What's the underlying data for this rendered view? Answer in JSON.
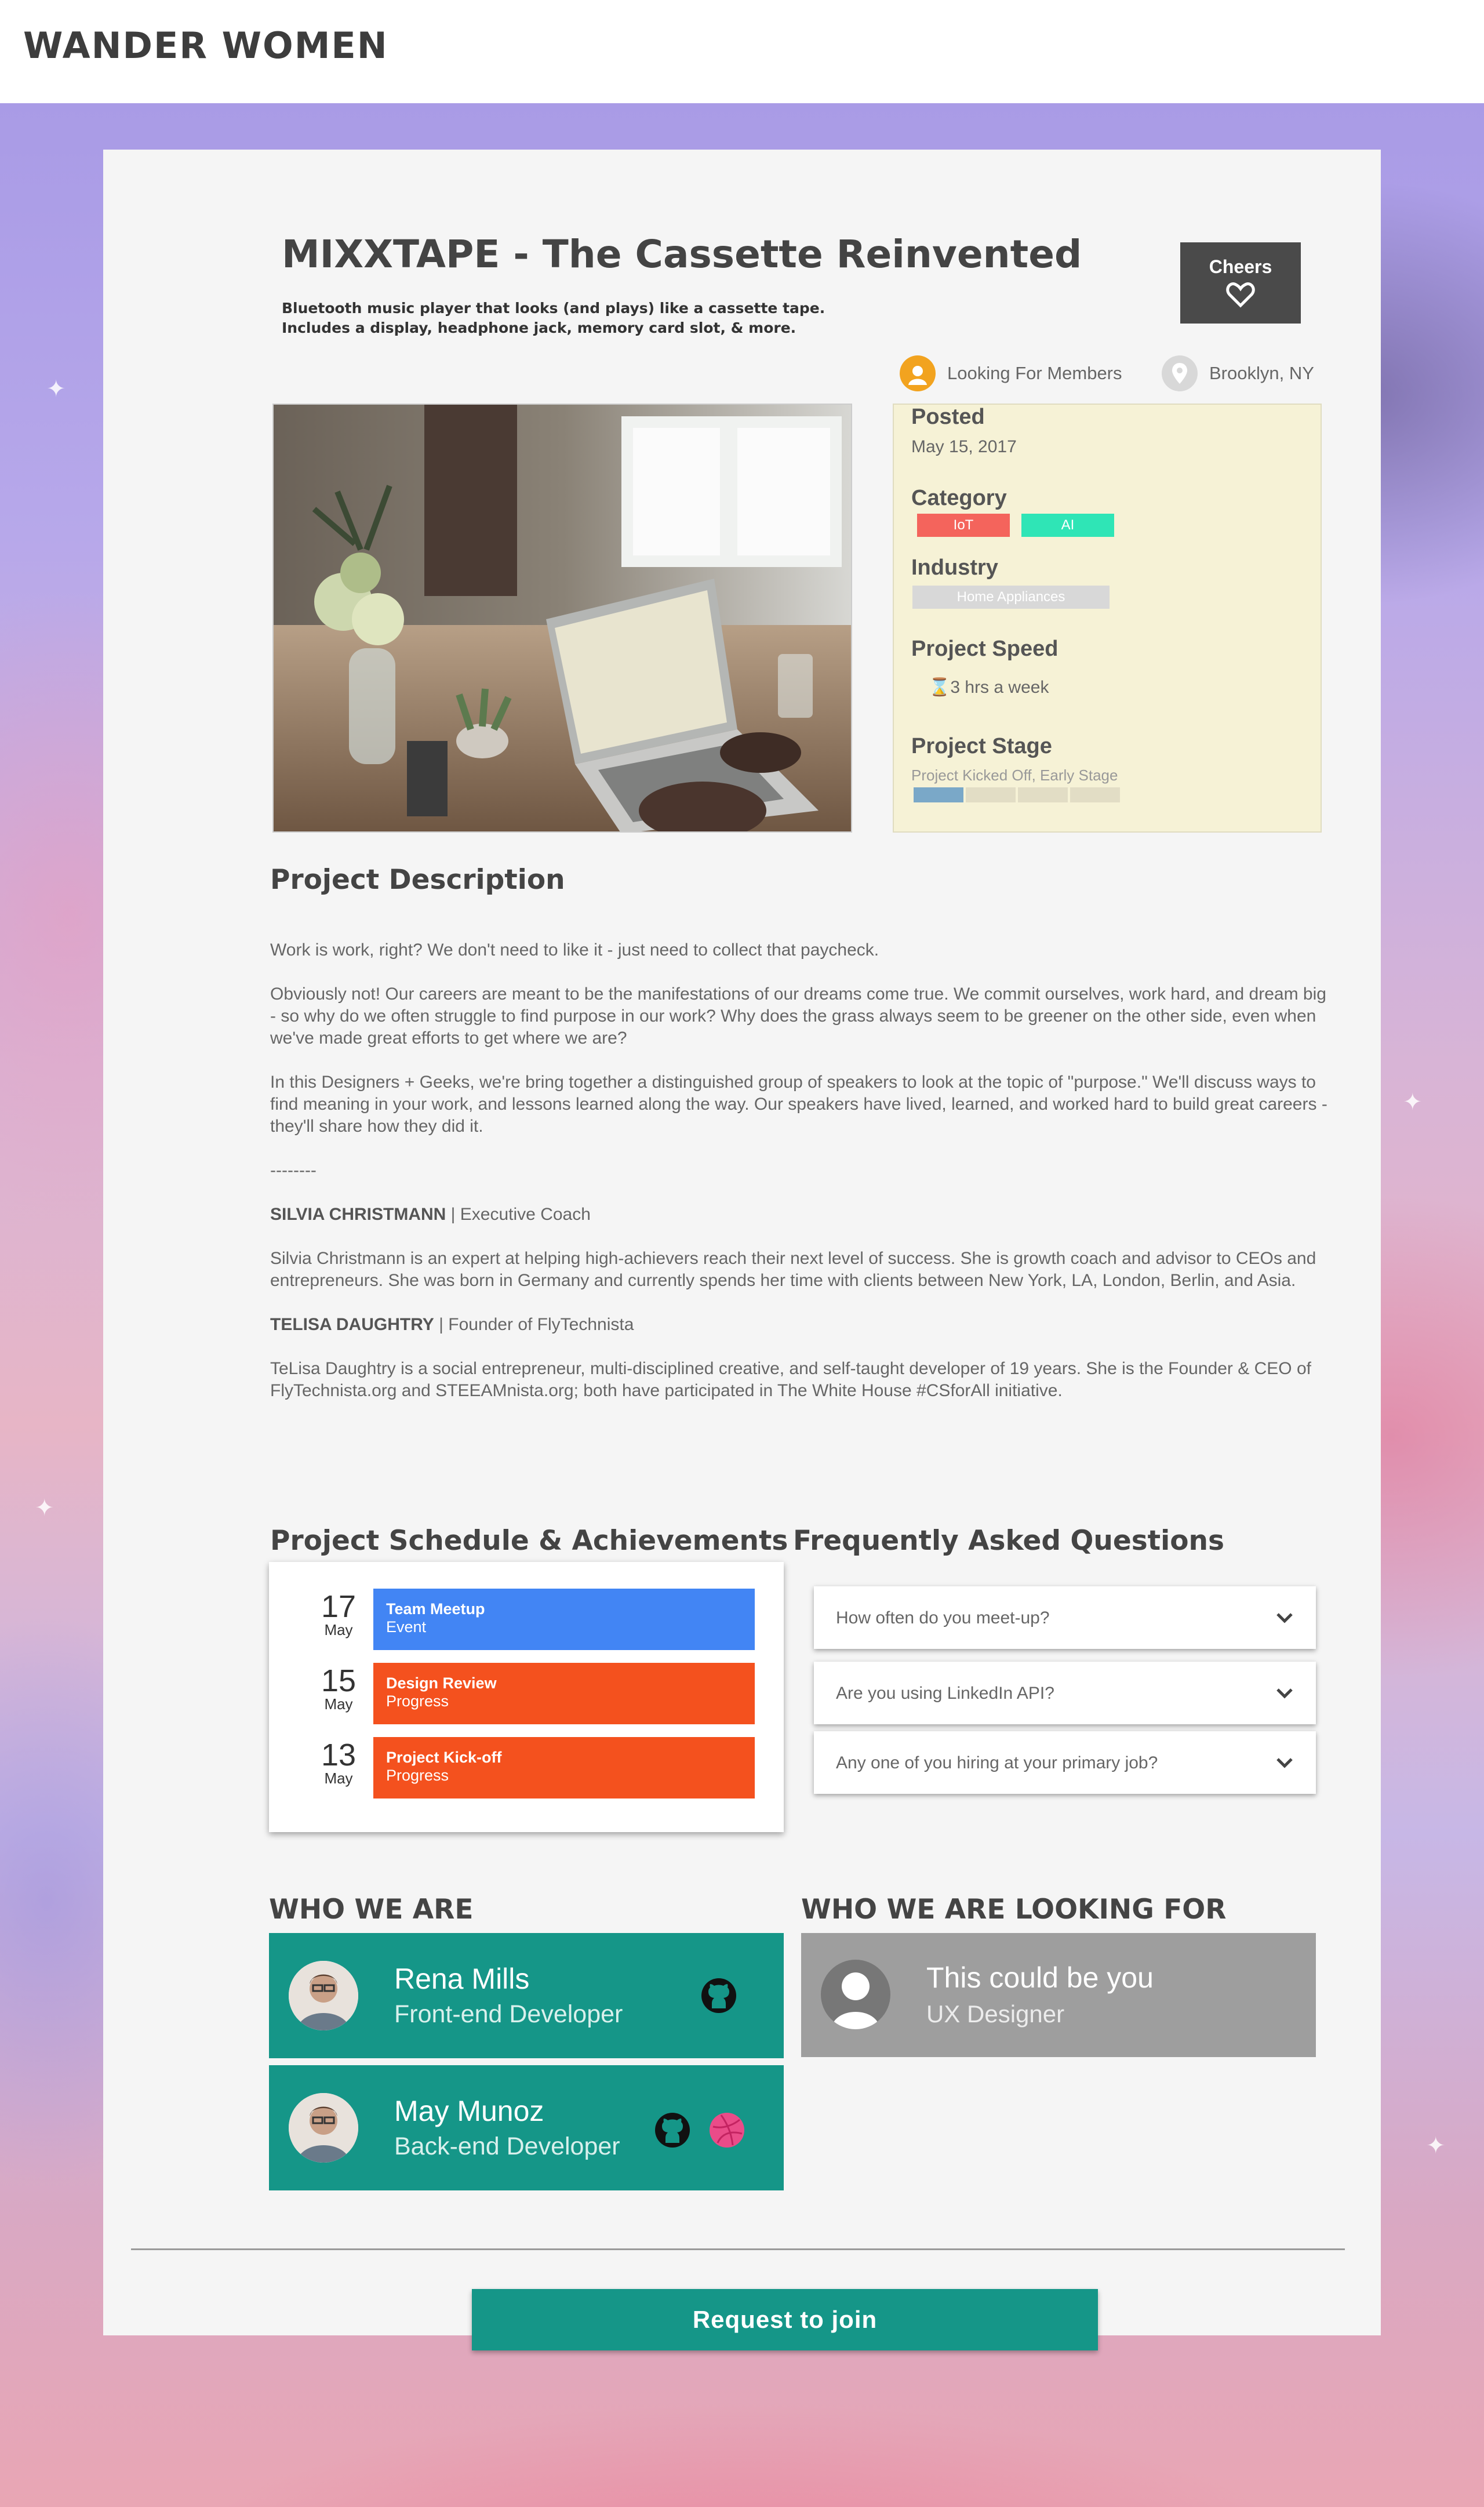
{
  "brand": "WANDER WOMEN",
  "project": {
    "title": "MIXXTAPE - The Cassette Reinvented",
    "subtitle_line1": "Bluetooth music player that looks (and plays) like a cassette tape.",
    "subtitle_line2": "Includes a display, headphone jack, memory card slot, & more."
  },
  "cheers_label": "Cheers",
  "meta": {
    "status": "Looking For Members",
    "location": "Brooklyn, NY"
  },
  "info": {
    "posted_label": "Posted",
    "posted_value": "May 15, 2017",
    "category_label": "Category",
    "categories": [
      "IoT",
      "AI"
    ],
    "industry_label": "Industry",
    "industry_value": "Home Appliances",
    "speed_label": "Project Speed",
    "speed_value": "3 hrs a week",
    "stage_label": "Project Stage",
    "stage_value": "Project Kicked Off, Early Stage",
    "stage_progress": "1 of 4"
  },
  "description": {
    "heading": "Project Description",
    "p1": "Work is work, right? We don't need to like it - just need to collect that paycheck.",
    "p2": "Obviously not! Our careers are meant to be the manifestations of our dreams come true. We commit ourselves, work hard, and dream big - so why do we often struggle to find purpose in our work? Why does the grass always seem to be greener on the other side, even when we've made great efforts to get where we are?",
    "p3": "In this Designers + Geeks, we're bring together a distinguished group of speakers to look at the topic of \"purpose.\" We'll discuss ways to find meaning in your work, and lessons learned along the way. Our speakers have lived, learned, and worked hard to build great careers - they'll share how they did it.",
    "sep": "--------",
    "speaker1_name": "SILVIA CHRISTMANN",
    "speaker1_role": " | Executive Coach",
    "speaker1_bio": "Silvia Christmann is an expert at helping high-achievers reach their next level of success. She is growth coach and advisor to CEOs and entrepreneurs. She was born in Germany and currently spends her time with clients between New York, LA, London, Berlin, and Asia.",
    "speaker2_name": "TELISA DAUGHTRY",
    "speaker2_role": " | Founder of FlyTechnista",
    "speaker2_bio": "TeLisa Daughtry is a social entrepreneur, multi-disciplined creative, and self-taught developer of 19 years. She is the Founder & CEO of FlyTechnista.org and STEEAMnista.org; both have participated in The White House #CSforAll initiative."
  },
  "schedule": {
    "heading": "Project Schedule & Achievements",
    "events": [
      {
        "day": "17",
        "month": "May",
        "title": "Team Meetup",
        "type": "Event",
        "color": "#4285f4"
      },
      {
        "day": "15",
        "month": "May",
        "title": "Design Review",
        "type": "Progress",
        "color": "#f4511e"
      },
      {
        "day": "13",
        "month": "May",
        "title": "Project Kick-off",
        "type": "Progress",
        "color": "#f4511e"
      }
    ]
  },
  "faq": {
    "heading": "Frequently Asked Questions",
    "questions": [
      "How often do you meet-up?",
      "Are you using LinkedIn API?",
      "Any one of you hiring at your primary job?"
    ]
  },
  "team": {
    "heading": "WHO WE ARE",
    "members": [
      {
        "name": "Rena Mills",
        "role": "Front-end Developer",
        "icons": [
          "github-icon"
        ]
      },
      {
        "name": "May Munoz",
        "role": "Back-end Developer",
        "icons": [
          "github-icon",
          "dribbble-icon"
        ]
      }
    ]
  },
  "looking_for": {
    "heading": "WHO WE ARE LOOKING FOR",
    "name": "This could be you",
    "role": "UX Designer"
  },
  "join_label": "Request to join",
  "colors": {
    "teal": "#159688",
    "blue_event": "#4285f4",
    "orange_progress": "#f4511e",
    "iot_tag": "#f4645c",
    "ai_tag": "#2fe5b6",
    "status_icon": "#f2a31f"
  }
}
